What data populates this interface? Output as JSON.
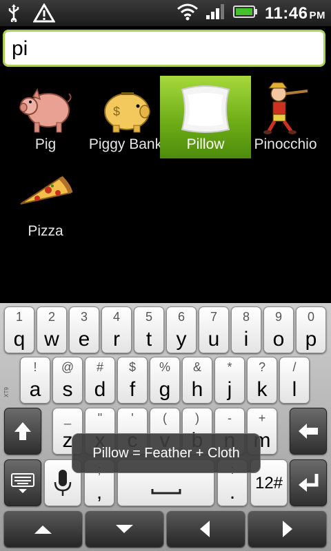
{
  "status_bar": {
    "time": "11:46",
    "ampm": "PM",
    "icons": [
      "usb-icon",
      "warning-icon",
      "wifi-icon",
      "signal-icon",
      "battery-icon"
    ]
  },
  "search": {
    "value": "pi"
  },
  "results": [
    {
      "label": "Pig",
      "icon": "pig-icon"
    },
    {
      "label": "Piggy Bank",
      "icon": "piggy-bank-icon"
    },
    {
      "label": "Pillow",
      "icon": "pillow-icon",
      "selected": true
    },
    {
      "label": "Pinocchio",
      "icon": "pinocchio-icon"
    },
    {
      "label": "Pizza",
      "icon": "pizza-icon"
    }
  ],
  "tooltip": "Pillow = Feather + Cloth",
  "keyboard": {
    "row1": [
      [
        "1",
        "q"
      ],
      [
        "2",
        "w"
      ],
      [
        "3",
        "e"
      ],
      [
        "4",
        "r"
      ],
      [
        "5",
        "t"
      ],
      [
        "6",
        "y"
      ],
      [
        "7",
        "u"
      ],
      [
        "8",
        "i"
      ],
      [
        "9",
        "o"
      ],
      [
        "0",
        "p"
      ]
    ],
    "row2": [
      [
        "!",
        "a"
      ],
      [
        "@",
        "s"
      ],
      [
        "#",
        "d"
      ],
      [
        "$",
        "f"
      ],
      [
        "%",
        "g"
      ],
      [
        "&",
        "h"
      ],
      [
        "*",
        "j"
      ],
      [
        "?",
        "k"
      ],
      [
        "/",
        "l"
      ]
    ],
    "row3": [
      [
        "_",
        "z"
      ],
      [
        "\"",
        "x"
      ],
      [
        "'",
        "c"
      ],
      [
        "(",
        "v"
      ],
      [
        ")",
        "b"
      ],
      [
        "-",
        "n"
      ],
      [
        "+",
        "m"
      ]
    ],
    "comma": [
      ";",
      ","
    ],
    "period": [
      ":",
      "."
    ],
    "numbers_label": "12#",
    "side_label": "XT9"
  },
  "colors": {
    "accent": "#8fc43a",
    "search_border": "#a9cf54"
  }
}
